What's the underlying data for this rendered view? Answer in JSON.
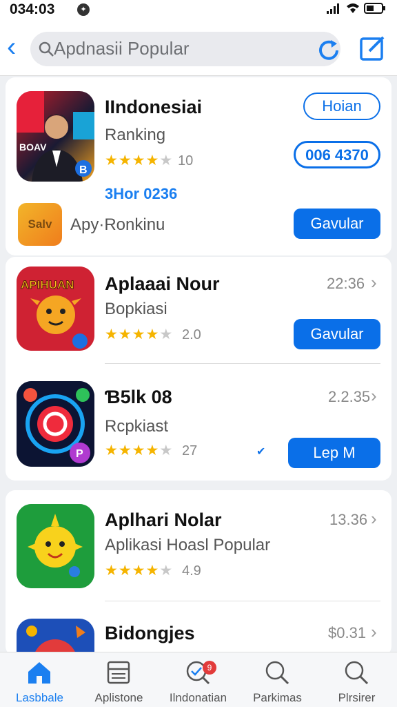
{
  "status": {
    "time": "034:03"
  },
  "search": {
    "placeholder": "Apdnasii Popular"
  },
  "featured": {
    "title": "IIndonesiai",
    "subtitle": "Ranking",
    "rating": "10",
    "stars": 3.5,
    "badge_code": "3Hor 0236",
    "open_label": "Hoian",
    "pill_label": "006 4370",
    "mini_icon_text": "Salv",
    "mini_label": "Apy·Ronkinu",
    "get_label": "Gavular"
  },
  "apps": [
    {
      "title": "Aplaaai Nour",
      "subtitle": "Bopkiasi",
      "rating": "2.0",
      "stars": 4,
      "price": "22:36",
      "button": "Gavular",
      "icon_text": "APIHUAN"
    },
    {
      "title": "Ɓ5lk 08",
      "subtitle": "Rcpkiast",
      "rating": "27",
      "stars": 4,
      "price": "2.2.35",
      "button": "Lep M"
    },
    {
      "title": "Aplhari Nolar",
      "subtitle": "Aplikasi Hoasl Popular",
      "rating": "4.9",
      "stars": 4.5,
      "price": "13.36"
    },
    {
      "title": "Bidongjes",
      "price": "$0.31"
    }
  ],
  "tabs": [
    {
      "label": "Lasbbale"
    },
    {
      "label": "Aplistone"
    },
    {
      "label": "Ilndonatian",
      "badge": "9"
    },
    {
      "label": "Parkimas"
    },
    {
      "label": "Plrsirer"
    }
  ],
  "colors": {
    "accent": "#0a6fe8",
    "star": "#f5b400"
  }
}
